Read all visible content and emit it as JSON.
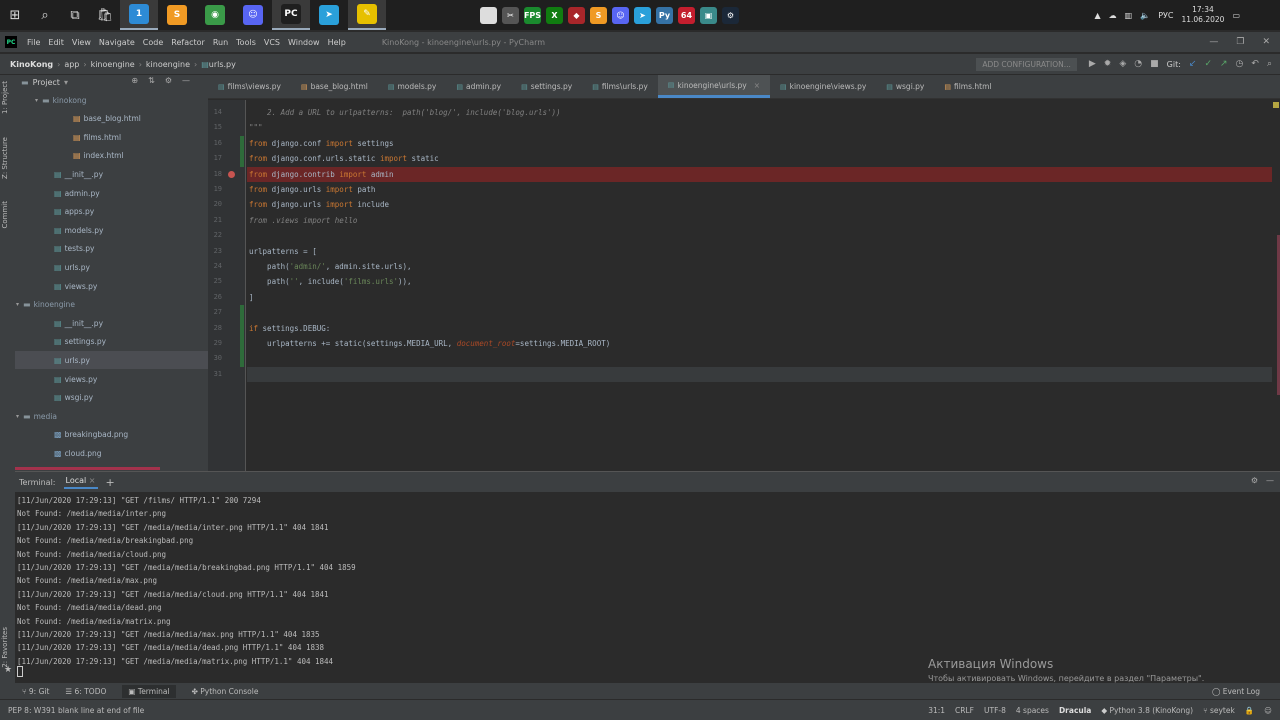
{
  "taskbar": {
    "apps": [
      {
        "name": "folder",
        "color": "#2d8bd6",
        "badge": "1"
      },
      {
        "name": "sublime",
        "color": "#f09a24",
        "badge": "S"
      },
      {
        "name": "chrome",
        "color": "#3a9a48",
        "badge": "◉"
      },
      {
        "name": "discord",
        "color": "#5865f2",
        "badge": "☺"
      },
      {
        "name": "pycharm",
        "color": "#1f1f1f",
        "badge": "PC"
      },
      {
        "name": "telegram",
        "color": "#2aa0da",
        "badge": "➤"
      },
      {
        "name": "notes",
        "color": "#e6c000",
        "badge": "✎"
      }
    ],
    "tray_apps": [
      {
        "name": "file",
        "color": "#dddddd",
        "label": ""
      },
      {
        "name": "tool",
        "color": "#555555",
        "label": "✂"
      },
      {
        "name": "gpu",
        "color": "#1a8a2e",
        "label": "FPS"
      },
      {
        "name": "xbox",
        "color": "#107c10",
        "label": "X"
      },
      {
        "name": "dota",
        "color": "#a8262a",
        "label": "◆"
      },
      {
        "name": "sublime",
        "color": "#f09a24",
        "label": "S"
      },
      {
        "name": "discord",
        "color": "#5865f2",
        "label": "☺"
      },
      {
        "name": "telegram",
        "color": "#2aa0da",
        "label": "➤"
      },
      {
        "name": "python",
        "color": "#3572a5",
        "label": "Py"
      },
      {
        "name": "aida",
        "color": "#c41e2e",
        "label": "64"
      },
      {
        "name": "game",
        "color": "#3a8a8a",
        "label": "▣"
      },
      {
        "name": "steam",
        "color": "#1b2838",
        "label": "⚙"
      }
    ],
    "lang": "РУС",
    "time": "17:34",
    "date": "11.06.2020"
  },
  "menubar": {
    "items": [
      "File",
      "Edit",
      "View",
      "Navigate",
      "Code",
      "Refactor",
      "Run",
      "Tools",
      "VCS",
      "Window",
      "Help"
    ],
    "title": "KinoKong - kinoengine\\urls.py - PyCharm"
  },
  "navbar": {
    "crumbs": [
      "KinoKong",
      "app",
      "kinoengine",
      "kinoengine",
      "urls.py"
    ],
    "add_config": "ADD CONFIGURATION...",
    "git_label": "Git:"
  },
  "left_strip": {
    "project": "1: Project",
    "structure": "Z: Structure",
    "commit": "Commit",
    "favorites": "2: Favorites"
  },
  "project_panel": {
    "title": "Project",
    "rows": [
      {
        "label": "kinokong",
        "type": "folder",
        "indent": 2,
        "arrow": "▾"
      },
      {
        "label": "base_blog.html",
        "type": "html",
        "indent": 4
      },
      {
        "label": "films.html",
        "type": "html",
        "indent": 4
      },
      {
        "label": "index.html",
        "type": "html",
        "indent": 4
      },
      {
        "label": "__init__.py",
        "type": "py",
        "indent": 3
      },
      {
        "label": "admin.py",
        "type": "py",
        "indent": 3
      },
      {
        "label": "apps.py",
        "type": "py",
        "indent": 3
      },
      {
        "label": "models.py",
        "type": "py",
        "indent": 3
      },
      {
        "label": "tests.py",
        "type": "py",
        "indent": 3
      },
      {
        "label": "urls.py",
        "type": "py",
        "indent": 3
      },
      {
        "label": "views.py",
        "type": "py",
        "indent": 3
      },
      {
        "label": "kinoengine",
        "type": "folder",
        "indent": 1,
        "arrow": "▾"
      },
      {
        "label": "__init__.py",
        "type": "py",
        "indent": 3
      },
      {
        "label": "settings.py",
        "type": "py",
        "indent": 3
      },
      {
        "label": "urls.py",
        "type": "py",
        "indent": 3,
        "selected": true
      },
      {
        "label": "views.py",
        "type": "py",
        "indent": 3
      },
      {
        "label": "wsgi.py",
        "type": "py",
        "indent": 3
      },
      {
        "label": "media",
        "type": "folder",
        "indent": 1,
        "arrow": "▾"
      },
      {
        "label": "breakingbad.png",
        "type": "img",
        "indent": 3
      },
      {
        "label": "cloud.png",
        "type": "img",
        "indent": 3
      }
    ]
  },
  "tabs": [
    {
      "label": "films\\views.py",
      "active": false
    },
    {
      "label": "base_blog.html",
      "active": false
    },
    {
      "label": "models.py",
      "active": false
    },
    {
      "label": "admin.py",
      "active": false
    },
    {
      "label": "settings.py",
      "active": false
    },
    {
      "label": "films\\urls.py",
      "active": false
    },
    {
      "label": "kinoengine\\urls.py",
      "active": true
    },
    {
      "label": "kinoengine\\views.py",
      "active": false
    },
    {
      "label": "wsgi.py",
      "active": false
    },
    {
      "label": "films.html",
      "active": false
    }
  ],
  "code_lines": [
    {
      "n": "14",
      "html": "<span class=\"dcm\">    2. Add a URL to urlpatterns:  path('blog/', include('blog.urls'))</span>"
    },
    {
      "n": "15",
      "html": "<span class=\"dcm\">\"\"\"</span>"
    },
    {
      "n": "16",
      "html": "<span class=\"kw\">from</span> django.conf <span class=\"kw\">import</span> settings",
      "chg": "add"
    },
    {
      "n": "17",
      "html": "<span class=\"kw\">from</span> django.conf.urls.static <span class=\"kw\">import</span> static",
      "chg": "add"
    },
    {
      "n": "18",
      "html": "<span class=\"kw\">from</span> django.contrib <span class=\"kw\">import</span> admin",
      "bp": true
    },
    {
      "n": "19",
      "html": "<span class=\"kw\">from</span> django.urls <span class=\"kw\">import</span> path"
    },
    {
      "n": "20",
      "html": "<span class=\"kw\">from</span> django.urls <span class=\"kw\">import</span> include"
    },
    {
      "n": "21",
      "html": "<span class=\"dcm\">from .views import hello</span>"
    },
    {
      "n": "22",
      "html": ""
    },
    {
      "n": "23",
      "html": "urlpatterns = ["
    },
    {
      "n": "24",
      "html": "    path(<span class=\"str\">'admin/'</span>, admin.site.urls),"
    },
    {
      "n": "25",
      "html": "    path(<span class=\"str\">''</span>, include(<span class=\"str\">'films.urls'</span>)),"
    },
    {
      "n": "26",
      "html": "]"
    },
    {
      "n": "27",
      "html": "",
      "chg": "add"
    },
    {
      "n": "28",
      "html": "<span class=\"kw\">if</span> settings.DEBUG:",
      "chg": "add"
    },
    {
      "n": "29",
      "html": "    urlpatterns += static(settings.MEDIA_URL, <span class=\"prm\">document_root</span>=settings.MEDIA_ROOT)",
      "chg": "add"
    },
    {
      "n": "30",
      "html": "",
      "chg": "add"
    },
    {
      "n": "31",
      "html": "",
      "cur": true
    }
  ],
  "terminal": {
    "label": "Terminal:",
    "tab": "Local",
    "lines": [
      "[11/Jun/2020 17:29:13] \"GET /films/ HTTP/1.1\" 200 7294",
      "Not Found: /media/media/inter.png",
      "[11/Jun/2020 17:29:13] \"GET /media/media/inter.png HTTP/1.1\" 404 1841",
      "Not Found: /media/media/breakingbad.png",
      "Not Found: /media/media/cloud.png",
      "[11/Jun/2020 17:29:13] \"GET /media/media/breakingbad.png HTTP/1.1\" 404 1859",
      "Not Found: /media/media/max.png",
      "[11/Jun/2020 17:29:13] \"GET /media/media/cloud.png HTTP/1.1\" 404 1841",
      "Not Found: /media/media/dead.png",
      "Not Found: /media/media/matrix.png",
      "[11/Jun/2020 17:29:13] \"GET /media/media/max.png HTTP/1.1\" 404 1835",
      "[11/Jun/2020 17:29:13] \"GET /media/media/dead.png HTTP/1.1\" 404 1838",
      "[11/Jun/2020 17:29:13] \"GET /media/media/matrix.png HTTP/1.1\" 404 1844"
    ]
  },
  "activation": {
    "title": "Активация Windows",
    "subtitle": "Чтобы активировать Windows, перейдите в раздел \"Параметры\"."
  },
  "toolwindows": {
    "git": "9: Git",
    "todo": "6: TODO",
    "terminal": "Terminal",
    "python_console": "Python Console",
    "event_log": "Event Log"
  },
  "statusbar": {
    "message": "PEP 8: W391 blank line at end of file",
    "position": "31:1",
    "line_sep": "CRLF",
    "encoding": "UTF-8",
    "indent": "4 spaces",
    "theme": "Dracula",
    "interpreter": "Python 3.8 (KinoKong)",
    "user": "seytek"
  }
}
